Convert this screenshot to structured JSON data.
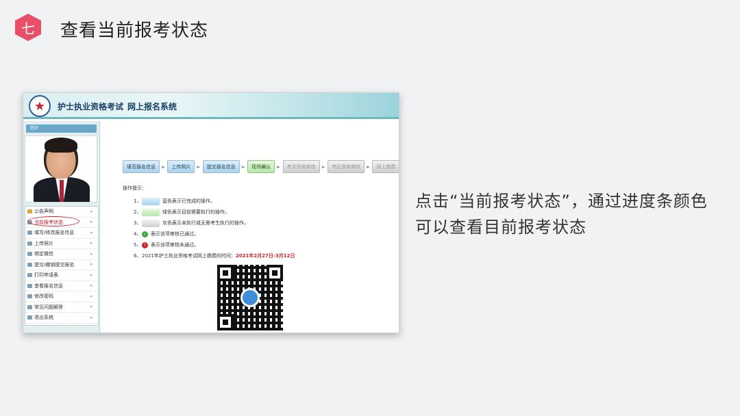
{
  "slide": {
    "number_glyph": "七",
    "title": "查看当前报考状态",
    "caption": "点击“当前报考状态”，通过进度条颜色可以查看目前报考状态",
    "accent_color": "#e8506a"
  },
  "app": {
    "title": "护士执业资格考试",
    "subtitle": "网上报名系统",
    "welcome": "您好",
    "logo_icon": "star-emblem-icon"
  },
  "menu": {
    "items": [
      {
        "label": "公告声明"
      },
      {
        "label": "当前报考状态"
      },
      {
        "label": "填写/修改报名信息"
      },
      {
        "label": "上传照片"
      },
      {
        "label": "绑定微信"
      },
      {
        "label": "提交/撤销提交报名"
      },
      {
        "label": "打印申请表"
      },
      {
        "label": "查看报名信息"
      },
      {
        "label": "修改密码"
      },
      {
        "label": "常见问题解答"
      },
      {
        "label": "退出系统"
      }
    ]
  },
  "progress": {
    "steps": [
      {
        "label": "填写报名信息",
        "state": "done"
      },
      {
        "label": "上传照片",
        "state": "done"
      },
      {
        "label": "提交报名信息",
        "state": "done"
      },
      {
        "label": "现场确认",
        "state": "current"
      },
      {
        "label": "考点资格审核",
        "state": "pending"
      },
      {
        "label": "考区资格审核",
        "state": "pending"
      },
      {
        "label": "网上缴费",
        "state": "pending"
      }
    ],
    "arrow": "►"
  },
  "tips": {
    "title": "操作提示：",
    "rows": [
      {
        "num": "1、",
        "text": "蓝色表示已完成的操作。"
      },
      {
        "num": "2、",
        "text": "绿色表示目前需要执行的操作。"
      },
      {
        "num": "3、",
        "text": "灰色表示未执行或无需考生执行的操作。"
      },
      {
        "num": "4、",
        "text": "表示该项审核已通过。",
        "icon": "✓"
      },
      {
        "num": "5、",
        "text": "表示该项审核未通过。",
        "icon": "!"
      },
      {
        "num": "6、",
        "text": "2021年护士执业资格考试网上缴费的时间：",
        "highlight": "2021年2月27日-3月12日"
      }
    ]
  }
}
